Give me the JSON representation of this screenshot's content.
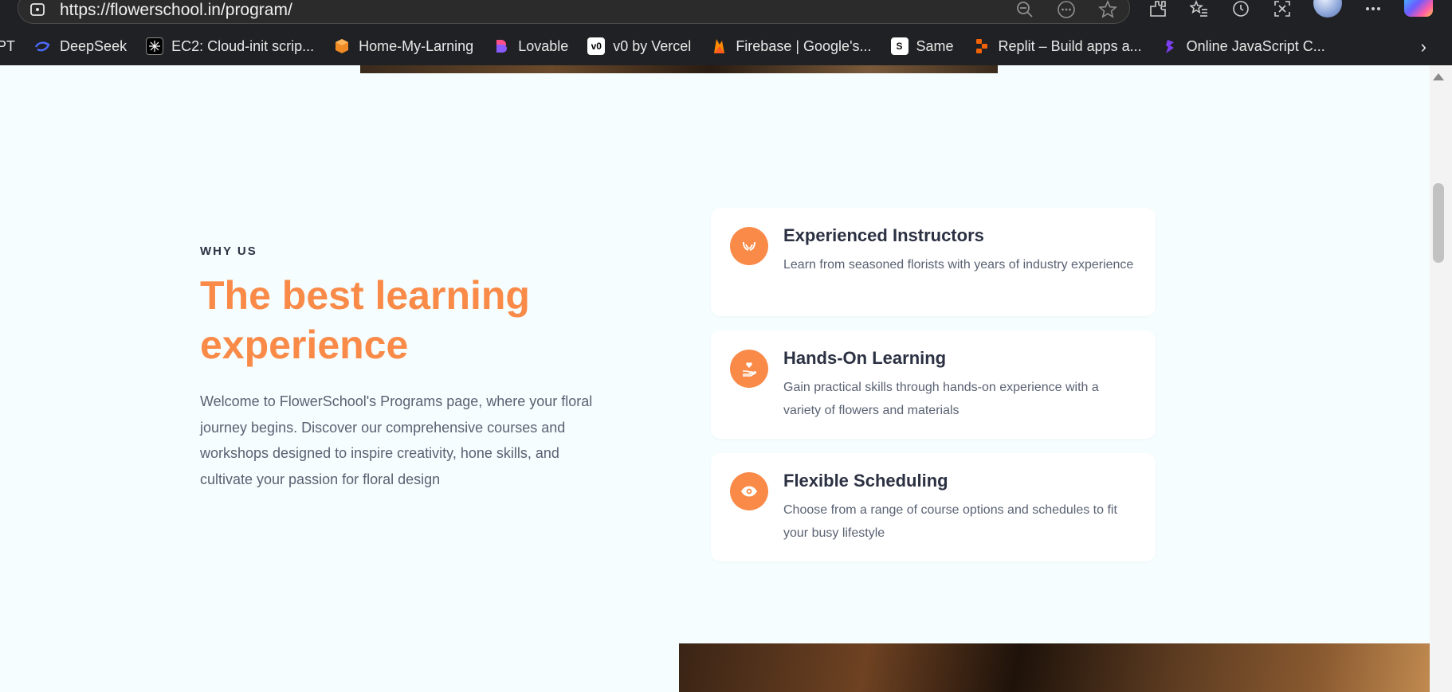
{
  "browser": {
    "url": "https://flowerschool.in/program/",
    "bookmarks": [
      {
        "label": "PT",
        "icon": "chatgpt-icon",
        "color": "#202124"
      },
      {
        "label": "DeepSeek",
        "icon": "deepseek-icon",
        "color": "#4d6bfe"
      },
      {
        "label": "EC2: Cloud-init scrip...",
        "icon": "ec2-icon",
        "color": "#000000"
      },
      {
        "label": "Home-My-Larning",
        "icon": "box-icon",
        "color": "#f08a24"
      },
      {
        "label": "Lovable",
        "icon": "lovable-icon",
        "color": "#ff4f8b"
      },
      {
        "label": "v0 by Vercel",
        "icon": "v0-icon",
        "color": "#ffffff"
      },
      {
        "label": "Firebase | Google's...",
        "icon": "firebase-icon",
        "color": "#ff8a00"
      },
      {
        "label": "Same",
        "icon": "same-icon",
        "color": "#111111"
      },
      {
        "label": "Replit – Build apps a...",
        "icon": "replit-icon",
        "color": "#f26207"
      },
      {
        "label": "Online JavaScript C...",
        "icon": "js-compiler-icon",
        "color": "#7b3ff2"
      }
    ]
  },
  "section": {
    "eyebrow": "WHY US",
    "headline": "The best learning experience",
    "intro": "Welcome to FlowerSchool's Programs page, where your floral journey begins. Discover our comprehensive courses and workshops designed to inspire creativity, hone skills, and cultivate your passion for floral design"
  },
  "features": [
    {
      "title": "Experienced Instructors",
      "description": "Learn from seasoned florists with years of industry experience",
      "icon": "hands-icon"
    },
    {
      "title": "Hands-On Learning",
      "description": "Gain practical skills through hands-on experience with a variety of flowers and materials",
      "icon": "hand-heart-icon"
    },
    {
      "title": "Flexible Scheduling",
      "description": "Choose from a range of course options and schedules to fit your busy lifestyle",
      "icon": "eye-icon"
    }
  ],
  "colors": {
    "accent": "#f98a48",
    "page_bg": "#f5fdfe",
    "heading": "#2b3142",
    "body": "#5a6273"
  }
}
